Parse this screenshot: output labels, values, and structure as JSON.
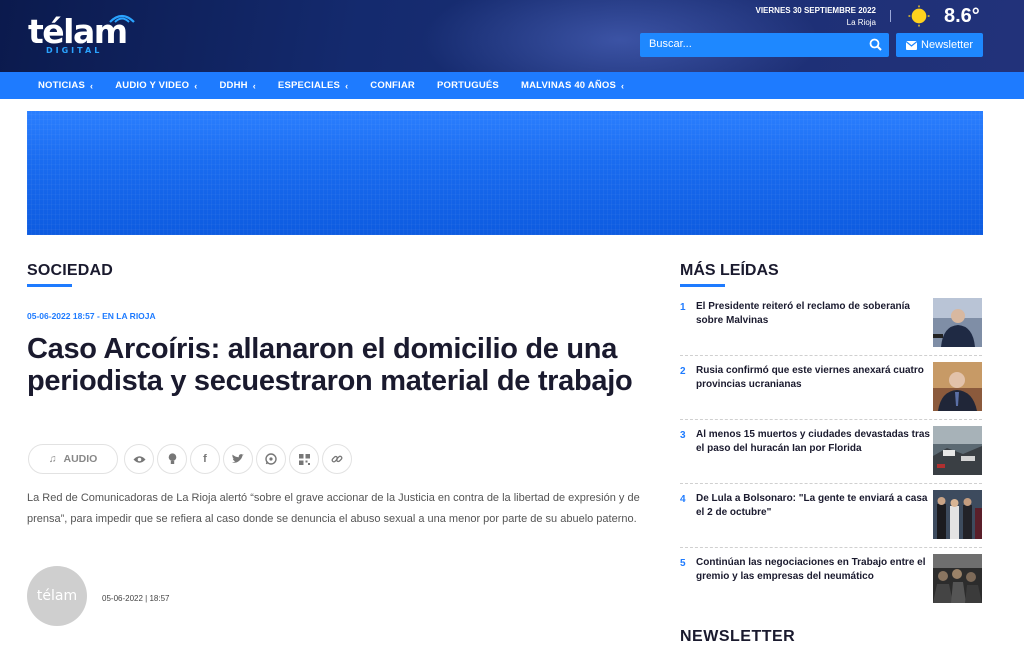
{
  "brand": {
    "logo_text": "télam",
    "logo_sub": "DIGITAL"
  },
  "header": {
    "date": "VIERNES 30 SEPTIEMBRE 2022",
    "location": "La Rioja",
    "temperature": "8.6°",
    "weather_icon": "sun-icon",
    "search_placeholder": "Buscar...",
    "newsletter_label": "Newsletter"
  },
  "nav": {
    "items": [
      {
        "label": "NOTICIAS",
        "has_submenu": true
      },
      {
        "label": "AUDIO Y VIDEO",
        "has_submenu": true
      },
      {
        "label": "DDHH",
        "has_submenu": true
      },
      {
        "label": "ESPECIALES",
        "has_submenu": true
      },
      {
        "label": "CONFIAR",
        "has_submenu": false
      },
      {
        "label": "PORTUGUÉS",
        "has_submenu": false
      },
      {
        "label": "MALVINAS 40 AÑOS",
        "has_submenu": true
      }
    ]
  },
  "article": {
    "section": "SOCIEDAD",
    "meta": "05-06-2022 18:57 - EN LA RIOJA",
    "headline": "Caso Arcoíris: allanaron el domicilio de una periodista y secuestraron material de trabajo",
    "audio_label": "AUDIO",
    "share_icons": [
      "eye-icon",
      "lightbulb-icon",
      "facebook-icon",
      "twitter-icon",
      "whatsapp-icon",
      "qr-icon",
      "link-icon"
    ],
    "lead": "La Red de Comunicadoras de La Rioja alertó “sobre el grave accionar de la Justicia en contra de la libertad de expresión y de prensa”, para impedir que se refiera al caso donde se denuncia el abuso sexual a una menor por parte de su abuelo paterno.",
    "author_avatar_text": "télam",
    "author_date": "05-06-2022 | 18:57"
  },
  "sidebar": {
    "title": "MÁS LEÍDAS",
    "items": [
      {
        "rank": "1",
        "title": "El Presidente reiteró el reclamo de soberanía sobre Malvinas"
      },
      {
        "rank": "2",
        "title": "Rusia confirmó que este viernes anexará cuatro provincias ucranianas"
      },
      {
        "rank": "3",
        "title": "Al menos 15 muertos y ciudades devastadas tras el paso del huracán Ian por Florida"
      },
      {
        "rank": "4",
        "title": "De Lula a Bolsonaro: \"La gente te enviará a casa el 2 de octubre\""
      },
      {
        "rank": "5",
        "title": "Continúan las negociaciones en Trabajo entre el gremio y las empresas del neumático"
      }
    ],
    "next_section": "NEWSLETTER"
  },
  "colors": {
    "accent": "#1e7bff",
    "header_bg": "#142a6e",
    "text_dark": "#1a1a2e"
  }
}
